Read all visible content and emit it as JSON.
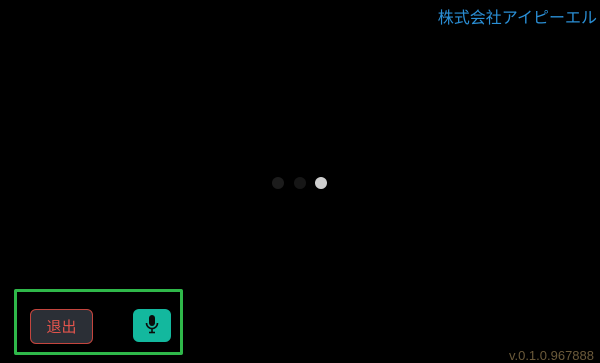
{
  "header": {
    "company_name": "株式会社アイピーエル"
  },
  "loading_indicator": {
    "dots": 3,
    "active_dot": 3
  },
  "controls": {
    "exit_label": "退出",
    "mic_icon": "microphone-icon"
  },
  "footer": {
    "version": "v.0.1.0.967888"
  },
  "colors": {
    "background": "#000000",
    "company_text": "#2a8fd6",
    "controls_border": "#2fb84a",
    "exit_text": "#e2544c",
    "mic_button": "#13b89e",
    "version_text": "#6b5a3a"
  }
}
